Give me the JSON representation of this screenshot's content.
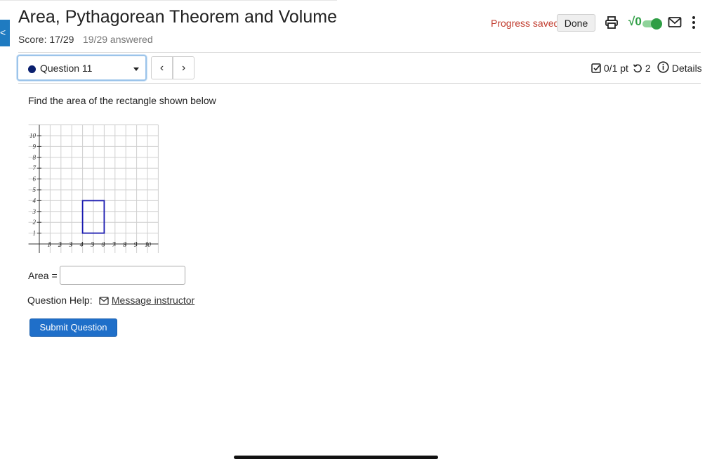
{
  "header": {
    "title": "Area, Pythagorean Theorem and Volume",
    "score": "Score: 17/29",
    "answered": "19/29 answered",
    "side_tab_glyph": "<",
    "progress_saved": "Progress saved",
    "done_label": "Done",
    "sqrt_label": "√0",
    "toggle_on": true,
    "icons": [
      "print-icon",
      "sqrt-toggle",
      "mail-icon",
      "kebab-icon"
    ]
  },
  "question_nav": {
    "selected": "Question 11",
    "prev_label": "‹",
    "next_label": "›",
    "points": "0/1 pt",
    "attempts": "2",
    "details_label": "Details"
  },
  "question": {
    "prompt": "Find the area of the rectangle shown below",
    "area_label": "Area =",
    "area_value": "",
    "help_label": "Question Help:",
    "message_link": "Message instructor",
    "submit_label": "Submit Question"
  },
  "graph": {
    "x_ticks": [
      "1",
      "2",
      "3",
      "4",
      "5",
      "6",
      "7",
      "8",
      "9",
      "10"
    ],
    "y_ticks": [
      "1",
      "2",
      "3",
      "4",
      "5",
      "6",
      "7",
      "8",
      "9",
      "10"
    ],
    "x_range": [
      -1,
      11
    ],
    "y_range": [
      -1,
      11
    ],
    "rectangle": {
      "x1": 4,
      "y1": 1,
      "x2": 6,
      "y2": 4
    },
    "rectangle_color": "#1a1ab0",
    "grid_color": "#cfcfcf"
  },
  "colors": {
    "accent": "#1f6fc9",
    "saved": "#c0392b",
    "toggle": "#2e9e44",
    "question_dot": "#0a1f6e"
  }
}
